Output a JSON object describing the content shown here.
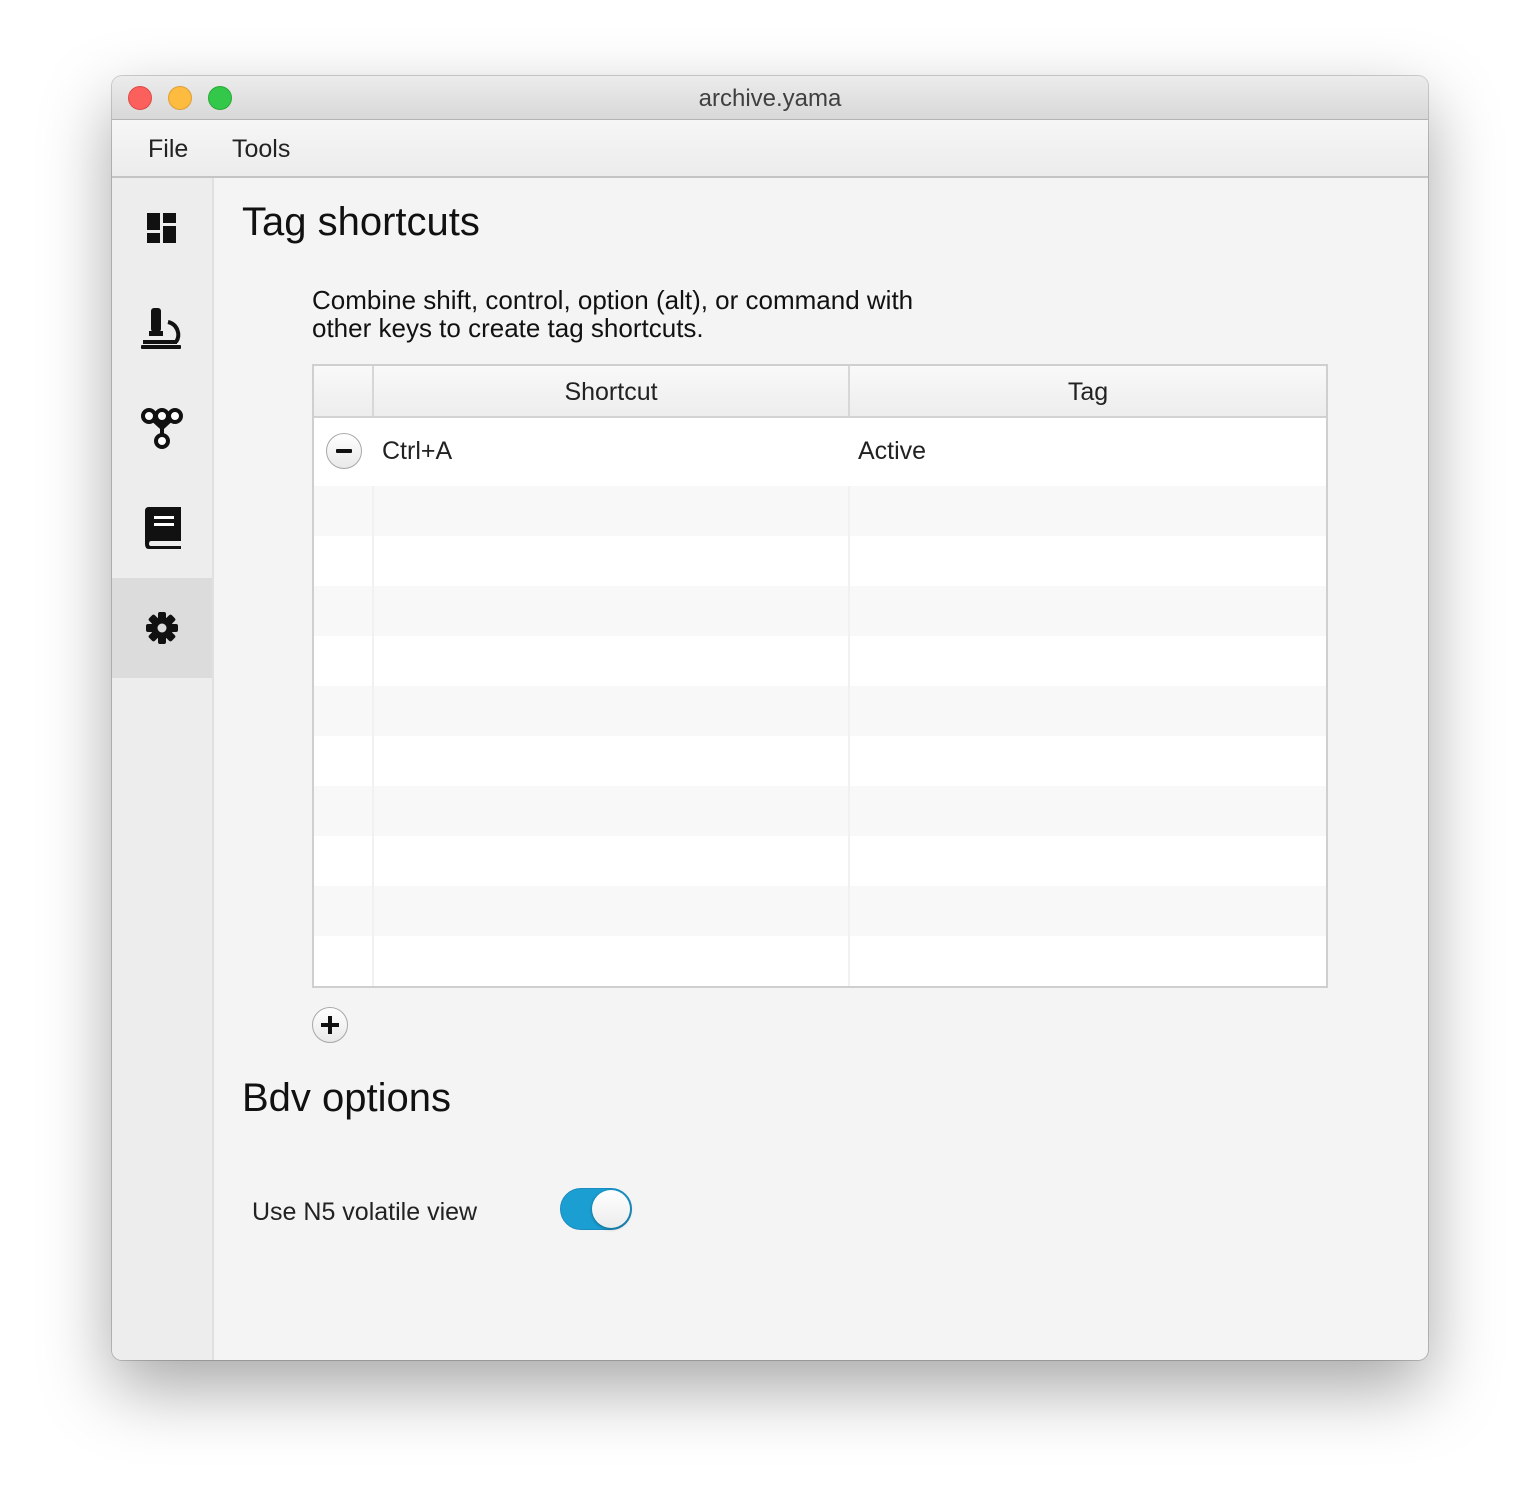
{
  "window": {
    "title": "archive.yama"
  },
  "menu": [
    {
      "label": "File"
    },
    {
      "label": "Tools"
    }
  ],
  "sidebar": {
    "items": [
      {
        "icon": "dashboard-icon",
        "active": false
      },
      {
        "icon": "microscope-icon",
        "active": false
      },
      {
        "icon": "hierarchy-icon",
        "active": false
      },
      {
        "icon": "book-icon",
        "active": false
      },
      {
        "icon": "gear-icon",
        "active": true
      }
    ]
  },
  "tag_shortcuts": {
    "title": "Tag shortcuts",
    "description_line1": "Combine shift, control, option (alt), or command with",
    "description_line2": "other keys to create tag shortcuts.",
    "columns": [
      "",
      "Shortcut",
      "Tag"
    ],
    "rows": [
      {
        "shortcut": "Ctrl+A",
        "tag": "Active"
      }
    ]
  },
  "bdv_options": {
    "title": "Bdv options",
    "use_n5_label": "Use N5 volatile view",
    "use_n5_enabled": true
  },
  "colors": {
    "toggle_on": "#1b9fd2",
    "active_nav": "#dcdcdc"
  }
}
